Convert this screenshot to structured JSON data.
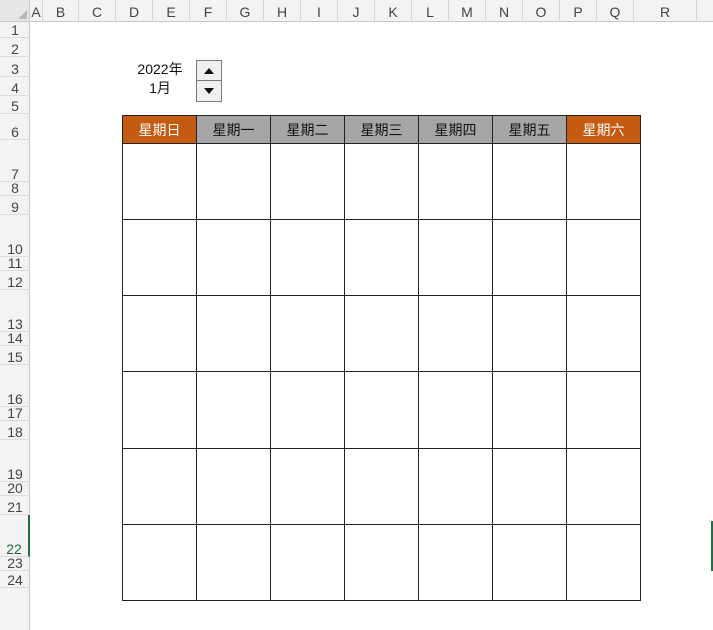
{
  "spreadsheet": {
    "columns": [
      "A",
      "B",
      "C",
      "D",
      "E",
      "F",
      "G",
      "H",
      "I",
      "J",
      "K",
      "L",
      "M",
      "N",
      "O",
      "P",
      "Q",
      "R"
    ],
    "rows": [
      "1",
      "2",
      "3",
      "4",
      "5",
      "6",
      "7",
      "8",
      "9",
      "10",
      "11",
      "12",
      "13",
      "14",
      "15",
      "16",
      "17",
      "18",
      "19",
      "20",
      "21",
      "22",
      "23",
      "24"
    ],
    "selected_row": "22"
  },
  "date_picker": {
    "year_text": "2022年",
    "month_text": "1月",
    "up_icon": "triangle-up-icon",
    "down_icon": "triangle-down-icon"
  },
  "calendar": {
    "weekdays": [
      "星期日",
      "星期一",
      "星期二",
      "星期三",
      "星期四",
      "星期五",
      "星期六"
    ],
    "weekend_color": "#c55a11",
    "weekday_color": "#a6a6a6",
    "week_rows": 6
  }
}
